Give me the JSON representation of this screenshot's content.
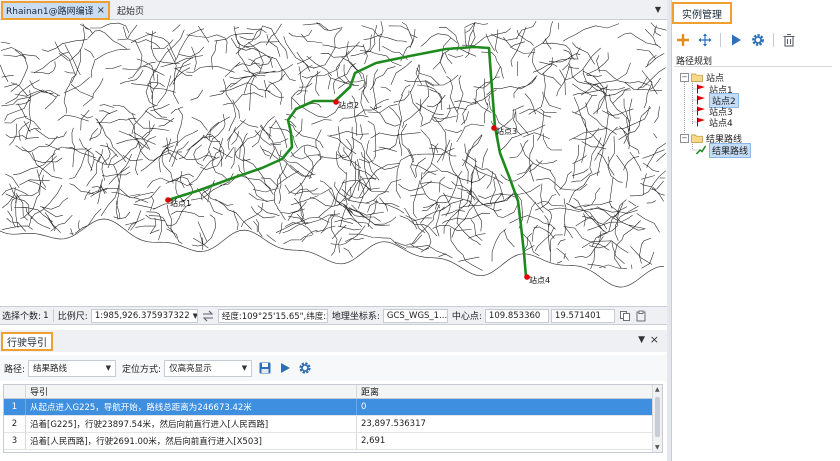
{
  "tabs": {
    "active_label": "Rhainan1@路网编译",
    "close_glyph": "×",
    "start_page_label": "起始页",
    "menu_glyph": "▼"
  },
  "map": {
    "stops": [
      {
        "label": "站点1"
      },
      {
        "label": "站点2"
      },
      {
        "label": "站点3"
      },
      {
        "label": "站点4"
      }
    ],
    "route_color": "#1e8a1e",
    "stop_color": "#e00000"
  },
  "statusbar": {
    "selected_count_label": "选择个数:",
    "selected_count_value": "1",
    "scale_label": "比例尺:",
    "scale_value": "1:985,926.375937322",
    "lonlat_value": "经度:109°25'15.65\",纬度:2...",
    "crs_label": "地理坐标系:",
    "crs_value": "GCS_WGS_1...",
    "center_label": "中心点:",
    "center_x": "109.853360",
    "center_y": "19.571401"
  },
  "guide_panel": {
    "title": "行驶导引",
    "pin_glyph": "▼",
    "close_glyph": "×",
    "route_label": "路径:",
    "route_value": "结果路线",
    "locate_label": "定位方式:",
    "locate_value": "仅高亮显示",
    "columns": [
      "导引",
      "距离"
    ],
    "rows": [
      {
        "index": "1",
        "guide": "从起点进入G225，导航开始，路线总距离为246673.42米",
        "distance": "0"
      },
      {
        "index": "2",
        "guide": "沿着[G225]，行驶23897.54米，然后向前直行进入[人民西路]",
        "distance": "23,897.536317"
      },
      {
        "index": "3",
        "guide": "沿着[人民西路]，行驶2691.00米，然后向前直行进入[X503]",
        "distance": "2,691"
      }
    ]
  },
  "instance_panel": {
    "title": "实例管理",
    "section_label": "路径规划",
    "tree": {
      "stops_folder": "站点",
      "stops": [
        "站点1",
        "站点2",
        "站点3",
        "站点4"
      ],
      "route_folder": "结果路线",
      "route_item": "结果路线"
    }
  },
  "icons": {
    "add": "plus-icon",
    "move": "move-icon",
    "run": "play-icon",
    "settings": "gear-icon",
    "delete": "trash-icon"
  }
}
